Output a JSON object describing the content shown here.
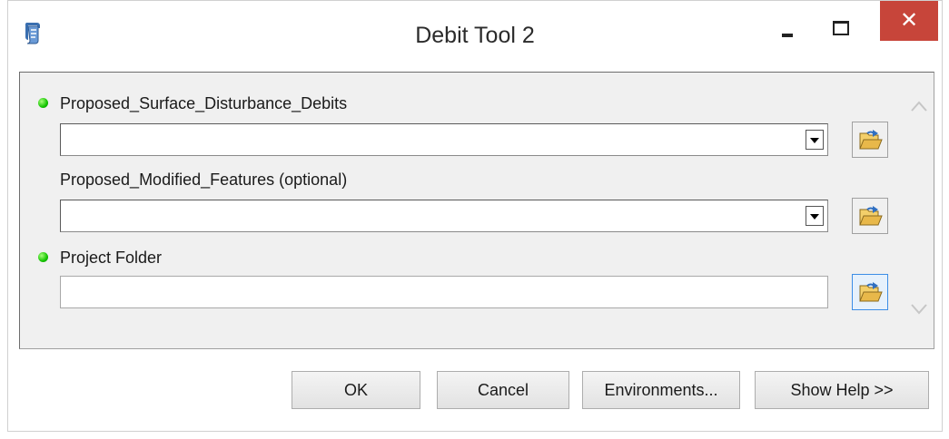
{
  "window": {
    "title": "Debit Tool 2",
    "icon": "python-script-icon",
    "close_glyph": "✕"
  },
  "parameters": [
    {
      "label": "Proposed_Surface_Disturbance_Debits",
      "required": true,
      "value": "",
      "control": "combo"
    },
    {
      "label": "Proposed_Modified_Features (optional)",
      "required": false,
      "value": "",
      "control": "combo"
    },
    {
      "label": "Project Folder",
      "required": true,
      "value": "",
      "control": "text"
    }
  ],
  "buttons": {
    "ok": "OK",
    "cancel": "Cancel",
    "environments": "Environments...",
    "show_help": "Show Help >>"
  },
  "colors": {
    "close_button": "#c7453a",
    "required_dot": "#13c400",
    "folder_icon": "#e8b84a"
  }
}
